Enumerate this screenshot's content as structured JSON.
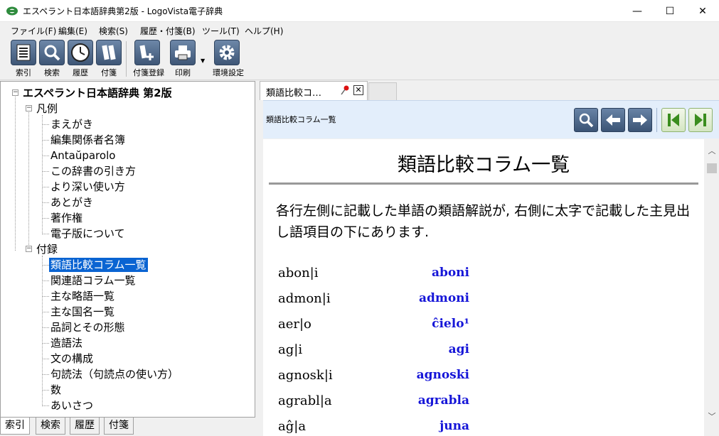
{
  "window": {
    "title": "エスペラント日本語辞典第2版 - LogoVista電子辞典",
    "minimize": "—",
    "maximize": "☐",
    "close": "✕"
  },
  "menu": [
    "ファイル(F)",
    "編集(E)",
    "検索(S)",
    "履歴・付箋(B)",
    "ツール(T)",
    "ヘルプ(H)"
  ],
  "toolbar": {
    "index": "索引",
    "search": "検索",
    "history": "履歴",
    "bookmarks": "付箋",
    "add_bookmark": "付箋登録",
    "print": "印刷",
    "settings": "環境設定"
  },
  "tree": {
    "root": "エスペラント日本語辞典 第2版",
    "folder1": "凡例",
    "folder1_items": [
      "まえがき",
      "編集関係者名簿",
      "Antaŭparolo",
      "この辞書の引き方",
      "より深い使い方",
      "あとがき",
      "著作権",
      "電子版について"
    ],
    "folder2": "付録",
    "folder2_items": [
      "類語比較コラム一覧",
      "関連語コラム一覧",
      "主な略語一覧",
      "主な国名一覧",
      "品詞とその形態",
      "造語法",
      "文の構成",
      "句読法（句読点の使い方）",
      "数",
      "あいさつ"
    ]
  },
  "left_tabs": [
    "索引",
    "検索",
    "履歴",
    "付箋"
  ],
  "doc_tab": {
    "label": "類語比較コ…",
    "close": "✕"
  },
  "nav": {
    "title": "類語比較コラム一覧"
  },
  "document": {
    "heading": "類語比較コラム一覧",
    "intro": "各行左側に記載した単語の類語解説が, 右側に太字で記載した主見出し語項目の下にあります.",
    "entries": [
      {
        "left": "abon|i",
        "right": "aboni"
      },
      {
        "left": "admon|i",
        "right": "admoni"
      },
      {
        "left": "aer|o",
        "right": "ĉielo¹"
      },
      {
        "left": "ag|i",
        "right": "agi"
      },
      {
        "left": "agnosk|i",
        "right": "agnoski"
      },
      {
        "left": "agrabl|a",
        "right": "agrabla"
      },
      {
        "left": "aĝ|a",
        "right": "juna"
      }
    ]
  },
  "colors": {
    "selection": "#0a64d2",
    "entry_link": "#1616d8",
    "nav_bar": "#e3eefb"
  }
}
